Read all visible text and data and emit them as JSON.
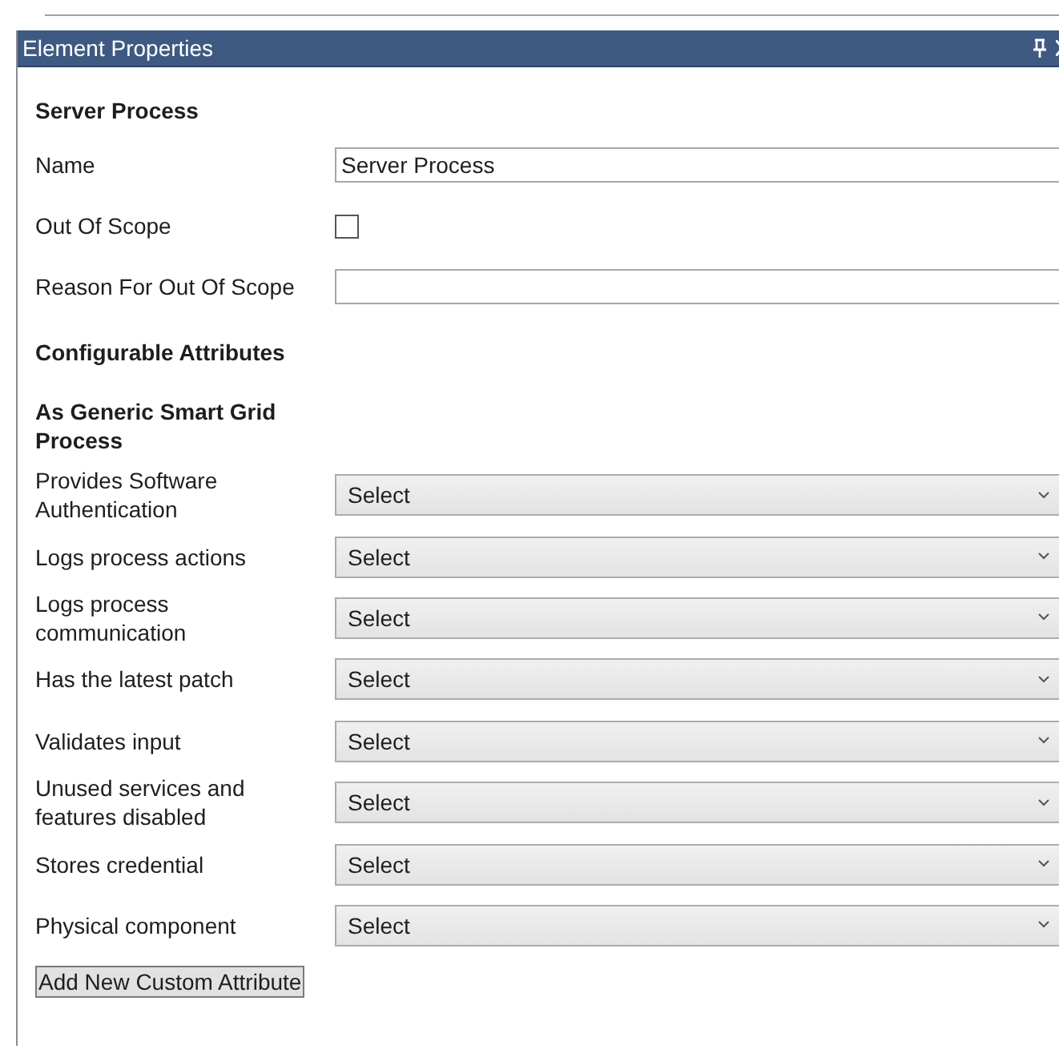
{
  "panel": {
    "title": "Element Properties"
  },
  "element": {
    "heading": "Server Process",
    "fields": [
      {
        "kind": "text",
        "label": "Name",
        "value": "Server Process"
      },
      {
        "kind": "checkbox",
        "label": "Out Of Scope",
        "checked": false
      },
      {
        "kind": "text",
        "label": "Reason For Out Of Scope"
      }
    ]
  },
  "configurable": {
    "heading": "Configurable Attributes",
    "group_heading": "As Generic Smart Grid Process",
    "attributes": [
      {
        "label": "Provides Software Authentication",
        "value": "Select"
      },
      {
        "label": "Logs process actions",
        "value": "Select"
      },
      {
        "label": "Logs process communication",
        "value": "Select"
      },
      {
        "label": "Has the latest patch",
        "value": "Select"
      },
      {
        "label": "Validates input",
        "value": "Select"
      },
      {
        "label": "Unused services and features disabled",
        "value": "Select"
      },
      {
        "label": "Stores credential",
        "value": "Select"
      },
      {
        "label": "Physical component",
        "value": "Select"
      }
    ]
  },
  "add_button": "Add New Custom Attribute"
}
